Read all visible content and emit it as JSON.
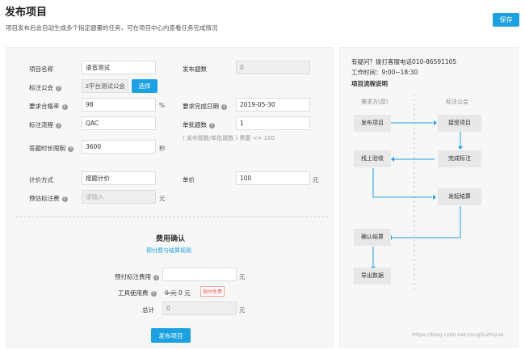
{
  "header": {
    "title": "发布项目",
    "subtitle": "项目发布后会自动生成多个指定题量的任务，可在项目中心内查看任务完成情况",
    "save_label": "保存"
  },
  "form": {
    "project_name_label": "项目名称",
    "project_name_value": "语音测试",
    "publish_count_label": "发布题数",
    "publish_count_value": "0",
    "company_label": "标注公会",
    "company_value": "z平台测试公会",
    "select_label": "选择",
    "pass_rate_label": "要求合格率",
    "pass_rate_value": "98",
    "pass_rate_unit": "%",
    "due_date_label": "要求完成日期",
    "due_date_value": "2019-05-30",
    "flow_label": "标注流程",
    "flow_value": "QAC",
    "batch_label": "单批题数",
    "batch_value": "1",
    "batch_hint": "( 发布题数/单批题数 ) 需要 <= 100",
    "time_limit_label": "答题时长限制",
    "time_limit_value": "3600",
    "time_limit_unit": "秒",
    "pricing_label": "计价方式",
    "pricing_value": "按题计价",
    "unit_price_label": "单价",
    "unit_price_value": "100",
    "unit_price_unit": "元",
    "estimate_label": "预估标注费",
    "estimate_placeholder": "请输入",
    "estimate_unit": "元"
  },
  "fee": {
    "title": "费用确认",
    "rules_link": "预付费与结算规则",
    "prepay_label": "预付标注费用",
    "prepay_unit": "元",
    "tool_label": "工具使用费",
    "tool_old": "0 元",
    "tool_new": "0 元",
    "tool_tag": "限时免费",
    "total_label": "总计",
    "total_value": "0",
    "total_unit": "元",
    "publish_label": "发布项目"
  },
  "side": {
    "contact": "有疑问？拨打客服电话010-86591105",
    "hours": "工作时间：9:00~18:30",
    "flow_title": "项目流程说明",
    "col_left": "需求方(您)",
    "col_right": "标注公会",
    "steps": {
      "publish": "发布项目",
      "accept": "接受项目",
      "finish": "完成标注",
      "check": "线上验收",
      "settle": "发起结算",
      "confirm": "确认结算",
      "export": "导出数据"
    },
    "accent": "#1ba1e2"
  },
  "watermark": "https://blog.csdn.net/rongliuzhiyue"
}
